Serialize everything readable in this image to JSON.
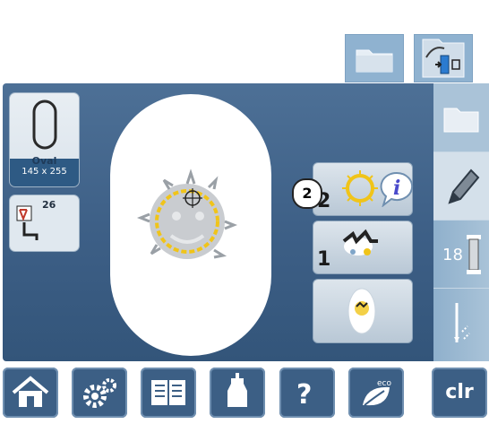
{
  "top_icons": [
    {
      "name": "folder-icon"
    },
    {
      "name": "transfer-icon"
    }
  ],
  "hoop": {
    "label": "Oval",
    "size": "145 x 255"
  },
  "stitch_counter": {
    "value": "26"
  },
  "layers": [
    {
      "number": "2",
      "icon": "sun-icon"
    },
    {
      "number": "1",
      "icon": "dog-icon"
    },
    {
      "number": "",
      "icon": "hoop-preview-icon"
    }
  ],
  "callout_number": "2",
  "right_panel": {
    "thread_count": "18"
  },
  "bottom_bar": {
    "icons": [
      "home-icon",
      "settings-icon",
      "tutorial-icon",
      "sewing-guide-icon",
      "help-icon",
      "eco-icon"
    ],
    "clr_label": "clr"
  }
}
